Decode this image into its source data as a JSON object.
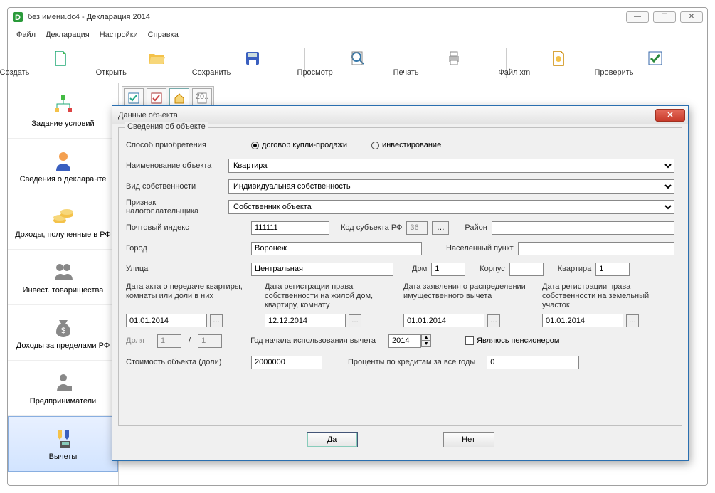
{
  "window": {
    "title": "без имени.dc4 - Декларация 2014"
  },
  "menubar": {
    "file": "Файл",
    "decl": "Декларация",
    "settings": "Настройки",
    "help": "Справка"
  },
  "toolbar": {
    "create": "Создать",
    "open": "Открыть",
    "save": "Сохранить",
    "preview": "Просмотр",
    "print": "Печать",
    "xml": "Файл xml",
    "check": "Проверить"
  },
  "sidebar": {
    "items": [
      "Задание условий",
      "Сведения о декларанте",
      "Доходы, полученные в РФ",
      "Инвест. товарищества",
      "Доходы за пределами РФ",
      "Предприниматели",
      "Вычеты"
    ]
  },
  "dialog": {
    "title": "Данные объекта",
    "group_title": "Сведения об объекте",
    "labels": {
      "acq_method": "Способ приобретения",
      "radio_purchase": "договор купли-продажи",
      "radio_invest": "инвестирование",
      "obj_name": "Наименование объекта",
      "ownership": "Вид собственности",
      "taxpayer_sign": "Признак налогоплательщика",
      "postcode": "Почтовый индекс",
      "subject_code": "Код субъекта РФ",
      "district": "Район",
      "city": "Город",
      "settlement": "Населенный пункт",
      "street": "Улица",
      "house": "Дом",
      "building": "Корпус",
      "flat": "Квартира",
      "date_act": "Дата акта о передаче квартиры, комнаты или доли в них",
      "date_reg_flat": "Дата регистрации права собственности на жилой дом, квартиру, комнату",
      "date_claim": "Дата заявления о распределении имущественного вычета",
      "date_reg_land": "Дата регистрации права собственности на земельный участок",
      "share": "Доля",
      "year_start": "Год начала использования вычета",
      "pensioner": "Являюсь пенсионером",
      "cost": "Стоимость объекта (доли)",
      "credit_interest": "Проценты по кредитам за все годы",
      "ok": "Да",
      "cancel": "Нет"
    },
    "values": {
      "obj_name": "Квартира",
      "ownership": "Индивидуальная собственность",
      "taxpayer_sign": "Собственник объекта",
      "postcode": "111111",
      "subject_code": "36",
      "district": "",
      "city": "Воронеж",
      "settlement": "",
      "street": "Центральная",
      "house": "1",
      "building": "",
      "flat": "1",
      "date_act": "01.01.2014",
      "date_reg_flat": "12.12.2014",
      "date_claim": "01.01.2014",
      "date_reg_land": "01.01.2014",
      "share_num": "1",
      "share_den": "1",
      "year_start": "2014",
      "cost": "2000000",
      "credit_interest": "0"
    }
  }
}
